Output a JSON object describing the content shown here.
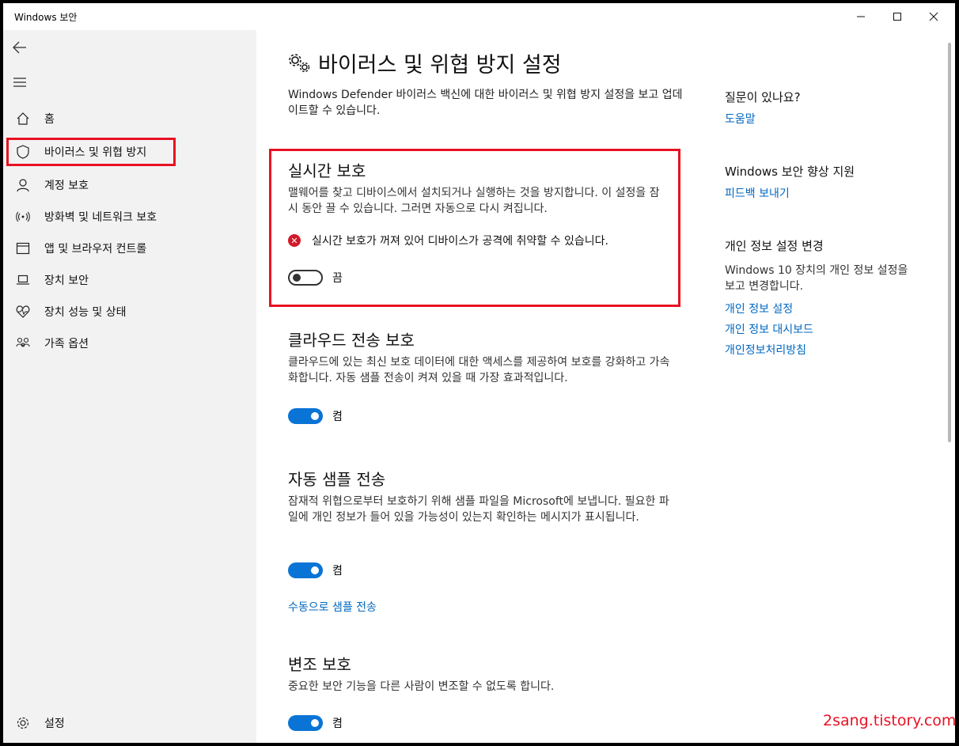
{
  "window": {
    "title": "Windows 보안"
  },
  "sidebar": {
    "items": [
      {
        "label": "홈",
        "icon": "home-icon"
      },
      {
        "label": "바이러스 및 위협 방지",
        "icon": "shield-icon"
      },
      {
        "label": "계정 보호",
        "icon": "person-icon"
      },
      {
        "label": "방화벽 및 네트워크 보호",
        "icon": "wireless-icon"
      },
      {
        "label": "앱 및 브라우저 컨트롤",
        "icon": "browser-window-icon"
      },
      {
        "label": "장치 보안",
        "icon": "laptop-icon"
      },
      {
        "label": "장치 성능 및 상태",
        "icon": "heart-pulse-icon"
      },
      {
        "label": "가족 옵션",
        "icon": "family-icon"
      }
    ],
    "settings_label": "설정"
  },
  "main": {
    "title": "바이러스 및 위협 방지 설정",
    "description": "Windows Defender 바이러스 백신에 대한 바이러스 및 위협 방지 설정을 보고 업데이트할 수 있습니다.",
    "realtime": {
      "heading": "실시간 보호",
      "description": "맬웨어를 찾고 디바이스에서 설치되거나 실행하는 것을 방지합니다. 이 설정을 잠시 동안 끌 수 있습니다. 그러면 자동으로 다시 켜집니다.",
      "warning": "실시간 보호가 꺼져 있어 디바이스가 공격에 취약할 수 있습니다.",
      "toggle_label": "끔"
    },
    "cloud": {
      "heading": "클라우드 전송 보호",
      "description": "클라우드에 있는 최신 보호 데이터에 대한 액세스를 제공하여 보호를 강화하고 가속화합니다. 자동 샘플 전송이 켜져 있을 때 가장 효과적입니다.",
      "toggle_label": "켬"
    },
    "sample": {
      "heading": "자동 샘플 전송",
      "description": "잠재적 위협으로부터 보호하기 위해 샘플 파일을 Microsoft에 보냅니다. 필요한 파일에 개인 정보가 들어 있을 가능성이 있는지 확인하는 메시지가 표시됩니다.",
      "toggle_label": "켬",
      "link": "수동으로 샘플 전송"
    },
    "tamper": {
      "heading": "변조 보호",
      "description": "중요한 보안 기능을 다른 사람이 변조할 수 없도록 합니다.",
      "toggle_label": "켬"
    }
  },
  "side": {
    "question_heading": "질문이 있나요?",
    "help_link": "도움말",
    "improve_heading": "Windows 보안 향상 지원",
    "feedback_link": "피드백 보내기",
    "privacy_heading": "개인 정보 설정 변경",
    "privacy_text": "Windows 10 장치의 개인 정보 설정을 보고 변경합니다.",
    "privacy_links": [
      "개인 정보 설정",
      "개인 정보 대시보드",
      "개인정보처리방침"
    ]
  },
  "watermark": "2sang.tistory.com",
  "colors": {
    "accent": "#0a74d6",
    "link": "#0067c0",
    "highlight": "#e81123",
    "error": "#d11a2a"
  }
}
